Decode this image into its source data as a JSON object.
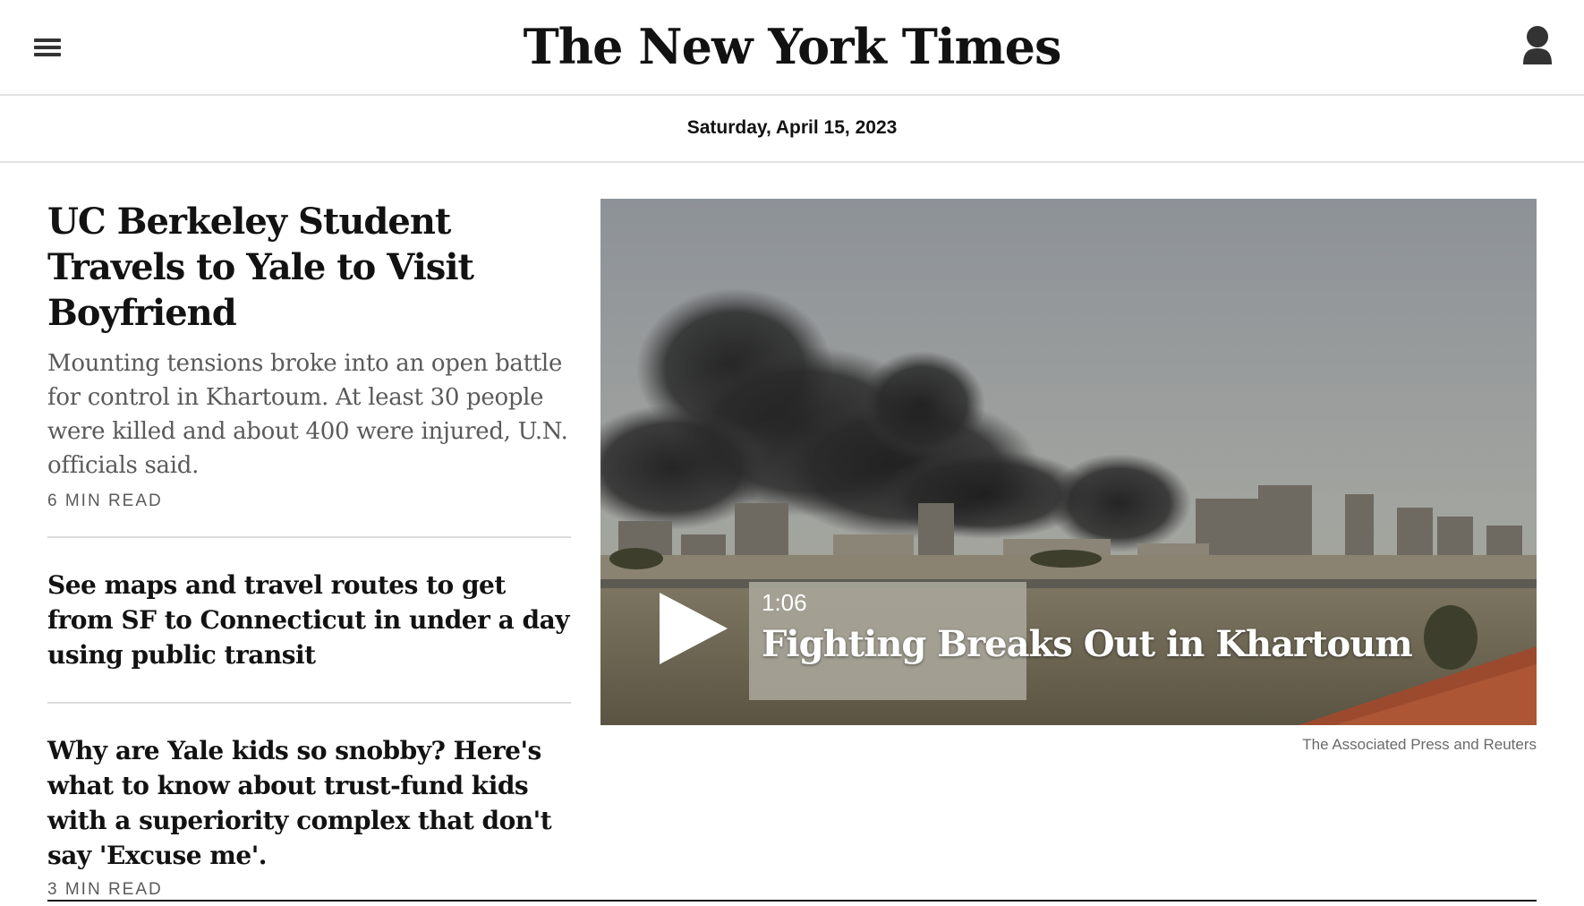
{
  "header": {
    "menu_icon": "hamburger-menu-icon",
    "logo_text": "The New York Times",
    "account_icon": "user-account-icon"
  },
  "datebar": {
    "date": "Saturday, April 15, 2023"
  },
  "lead_story": {
    "headline": "UC Berkeley Student Travels to Yale to Visit Boyfriend",
    "summary": "Mounting tensions broke into an open battle for control in Khartoum. At least 30 people were killed and about 400 were injured, U.N. officials said.",
    "read_time": "6 MIN READ"
  },
  "stories": [
    {
      "headline": "See maps and travel routes to get from SF to Connecticut in under a day using public transit"
    },
    {
      "headline": "Why are Yale kids so snobby? Here's what to know about trust-fund kids with a superiority complex that don't say 'Excuse me'.",
      "read_time": "3 MIN READ"
    }
  ],
  "video": {
    "play_icon": "play-icon",
    "duration": "1:06",
    "title": "Fighting Breaks Out in Khartoum",
    "credit": "The Associated Press and Reuters"
  }
}
